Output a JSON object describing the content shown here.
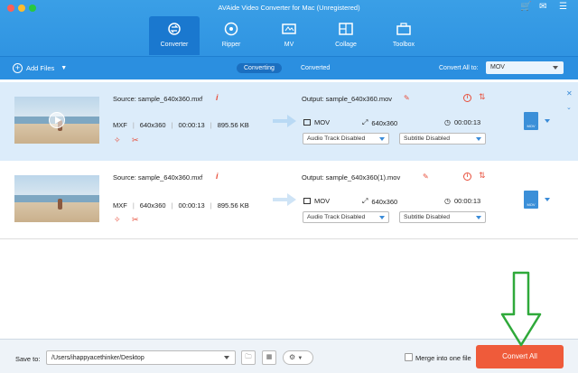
{
  "window": {
    "title": "AVAide Video Converter for Mac (Unregistered)"
  },
  "nav": {
    "tabs": [
      {
        "label": "Converter"
      },
      {
        "label": "Ripper"
      },
      {
        "label": "MV"
      },
      {
        "label": "Collage"
      },
      {
        "label": "Toolbox"
      }
    ],
    "active": "Converter"
  },
  "toolbar": {
    "add_files": "Add Files",
    "seg_converting": "Converting",
    "seg_converted": "Converted",
    "convert_all_label": "Convert All to:",
    "convert_all_value": "MOV"
  },
  "files": [
    {
      "source": "Source: sample_640x360.mxf",
      "format": "MXF",
      "resolution": "640x360",
      "duration": "00:00:13",
      "size": "895.56 KB",
      "output": "Output: sample_640x360.mov",
      "out_format": "MOV",
      "out_resolution": "640x360",
      "out_duration": "00:00:13",
      "audio": "Audio Track Disabled",
      "subtitle": "Subtitle Disabled",
      "format_badge": "MOV"
    },
    {
      "source": "Source: sample_640x360.mxf",
      "format": "MXF",
      "resolution": "640x360",
      "duration": "00:00:13",
      "size": "895.56 KB",
      "output": "Output: sample_640x360(1).mov",
      "out_format": "MOV",
      "out_resolution": "640x360",
      "out_duration": "00:00:13",
      "audio": "Audio Track Disabled",
      "subtitle": "Subtitle Disabled",
      "format_badge": "MOV"
    }
  ],
  "bottom": {
    "save_to_label": "Save to:",
    "save_path": "/Users/ihappyacethinker/Desktop",
    "merge_label": "Merge into one file",
    "merge_checked": false,
    "convert_button": "Convert All"
  },
  "colors": {
    "header_blue": "#2b8fe0",
    "accent_red": "#ef5b3a",
    "annotation_green": "#2fa93a"
  }
}
